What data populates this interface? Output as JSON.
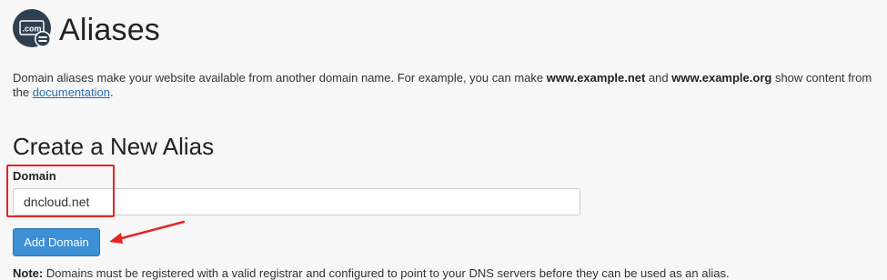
{
  "header": {
    "title": "Aliases",
    "icon": "domain-aliases-icon",
    "icon_text": ".com"
  },
  "description": {
    "text_before": "Domain aliases make your website available from another domain name. For example, you can make ",
    "example1": "www.example.net",
    "text_and": " and ",
    "example2": "www.example.org",
    "text_after": " show content from",
    "line2_prefix": "the ",
    "link_text": "documentation",
    "line2_suffix": "."
  },
  "form": {
    "title": "Create a New Alias",
    "domain_label": "Domain",
    "domain_value": "dncloud.net",
    "submit_label": "Add Domain"
  },
  "note": {
    "label": "Note:",
    "text": " Domains must be registered with a valid registrar and configured to point to your DNS servers before they can be used as an alias."
  },
  "colors": {
    "accent": "#3d8fd6",
    "annotation": "#e52424",
    "link": "#2a6fb3"
  }
}
